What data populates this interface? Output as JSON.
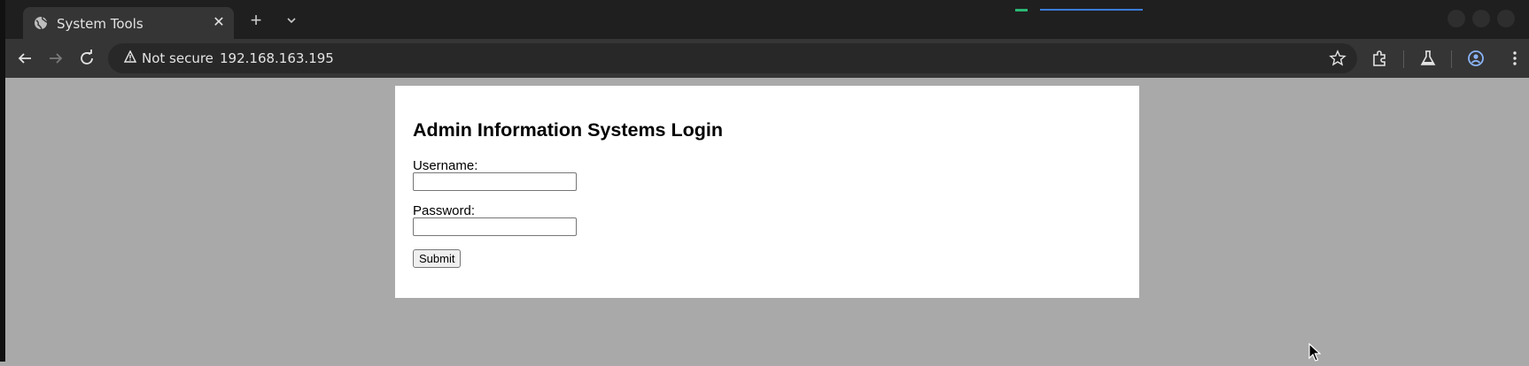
{
  "browser": {
    "tab": {
      "title": "System Tools"
    },
    "omnibox": {
      "security_label": "Not secure",
      "url": "192.168.163.195"
    }
  },
  "page": {
    "heading": "Admin Information Systems Login",
    "username_label": "Username:",
    "username_value": "",
    "password_label": "Password:",
    "password_value": "",
    "submit_label": "Submit"
  },
  "colors": {
    "page_background": "#a9a9a9",
    "card_background": "#ffffff",
    "chrome_dark": "#1f1f1f",
    "toolbar": "#353535"
  },
  "icons": [
    "globe-icon",
    "close-icon",
    "plus-icon",
    "chevron-down-icon",
    "back-arrow-icon",
    "forward-arrow-icon",
    "reload-icon",
    "warning-icon",
    "star-icon",
    "extensions-icon",
    "labs-flask-icon",
    "profile-icon",
    "kebab-menu-icon",
    "mouse-cursor-icon"
  ]
}
